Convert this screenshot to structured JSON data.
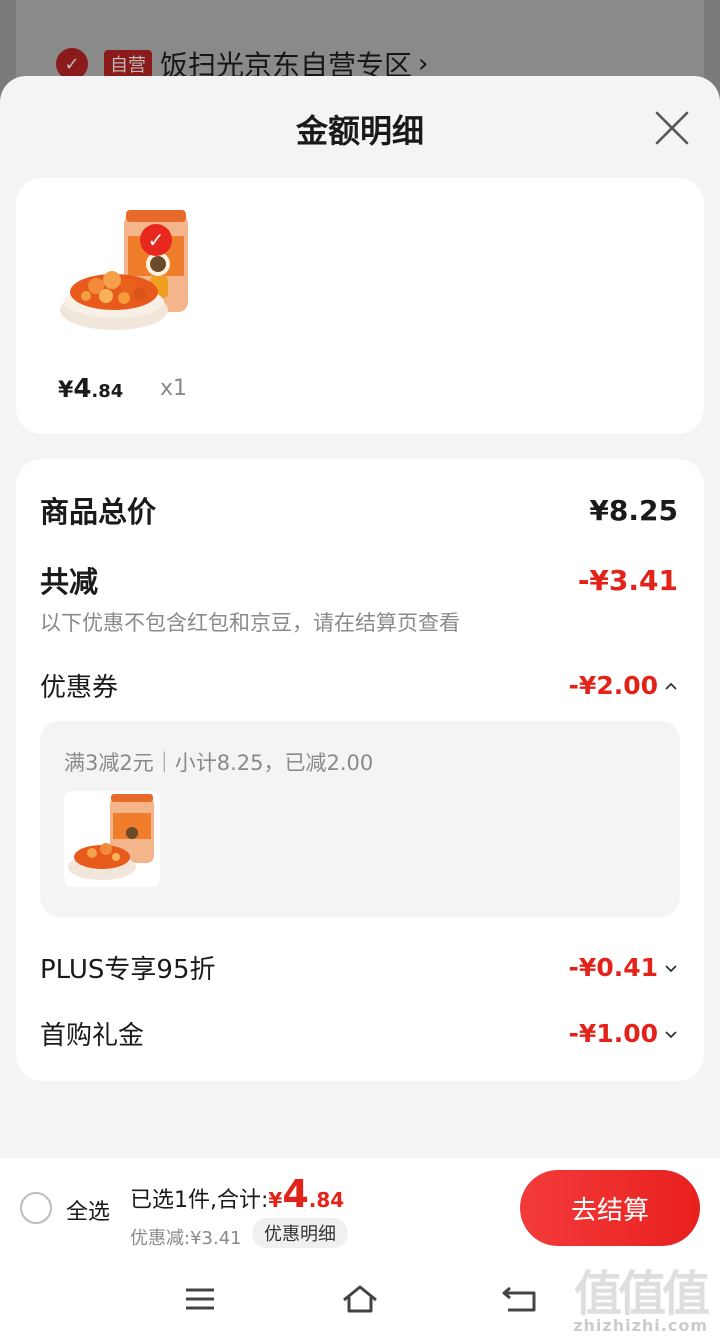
{
  "background_store": {
    "check_icon": "check-circle-icon",
    "tag": "自营",
    "name": "饭扫光京东自营专区",
    "chevron": "›"
  },
  "sheet": {
    "title": "金额明细",
    "close_icon": "close-icon"
  },
  "product": {
    "price_symbol": "¥",
    "price_int": "4",
    "price_dec": ".84",
    "qty": "x1",
    "selected": true
  },
  "details": {
    "total_label": "商品总价",
    "total_value": "¥8.25",
    "reduce_label": "共减",
    "reduce_value": "-¥3.41",
    "note": "以下优惠不包含红包和京豆，请在结算页查看",
    "coupon_label": "优惠券",
    "coupon_value": "-¥2.00",
    "coupon_desc": "满3减2元｜小计8.25，已减2.00",
    "plus_label": "PLUS专享95折",
    "plus_value": "-¥0.41",
    "first_label": "首购礼金",
    "first_value": "-¥1.00"
  },
  "bottom": {
    "select_all": "全选",
    "summary_prefix": "已选1件,合计:",
    "sum_symbol": "¥",
    "sum_int": "4",
    "sum_dec": ".84",
    "discount": "优惠减:¥3.41",
    "detail_chip": "优惠明细",
    "checkout": "去结算"
  },
  "nav": {
    "menu_icon": "menu-icon",
    "home_icon": "home-icon",
    "back_icon": "back-icon"
  },
  "watermark": {
    "glyphs": "值值值",
    "text": "zhizhizhi.com"
  },
  "colors": {
    "accent_red": "#e3231a",
    "sheet_bg": "#f4f4f4",
    "overlay": "#7a7a7a"
  }
}
